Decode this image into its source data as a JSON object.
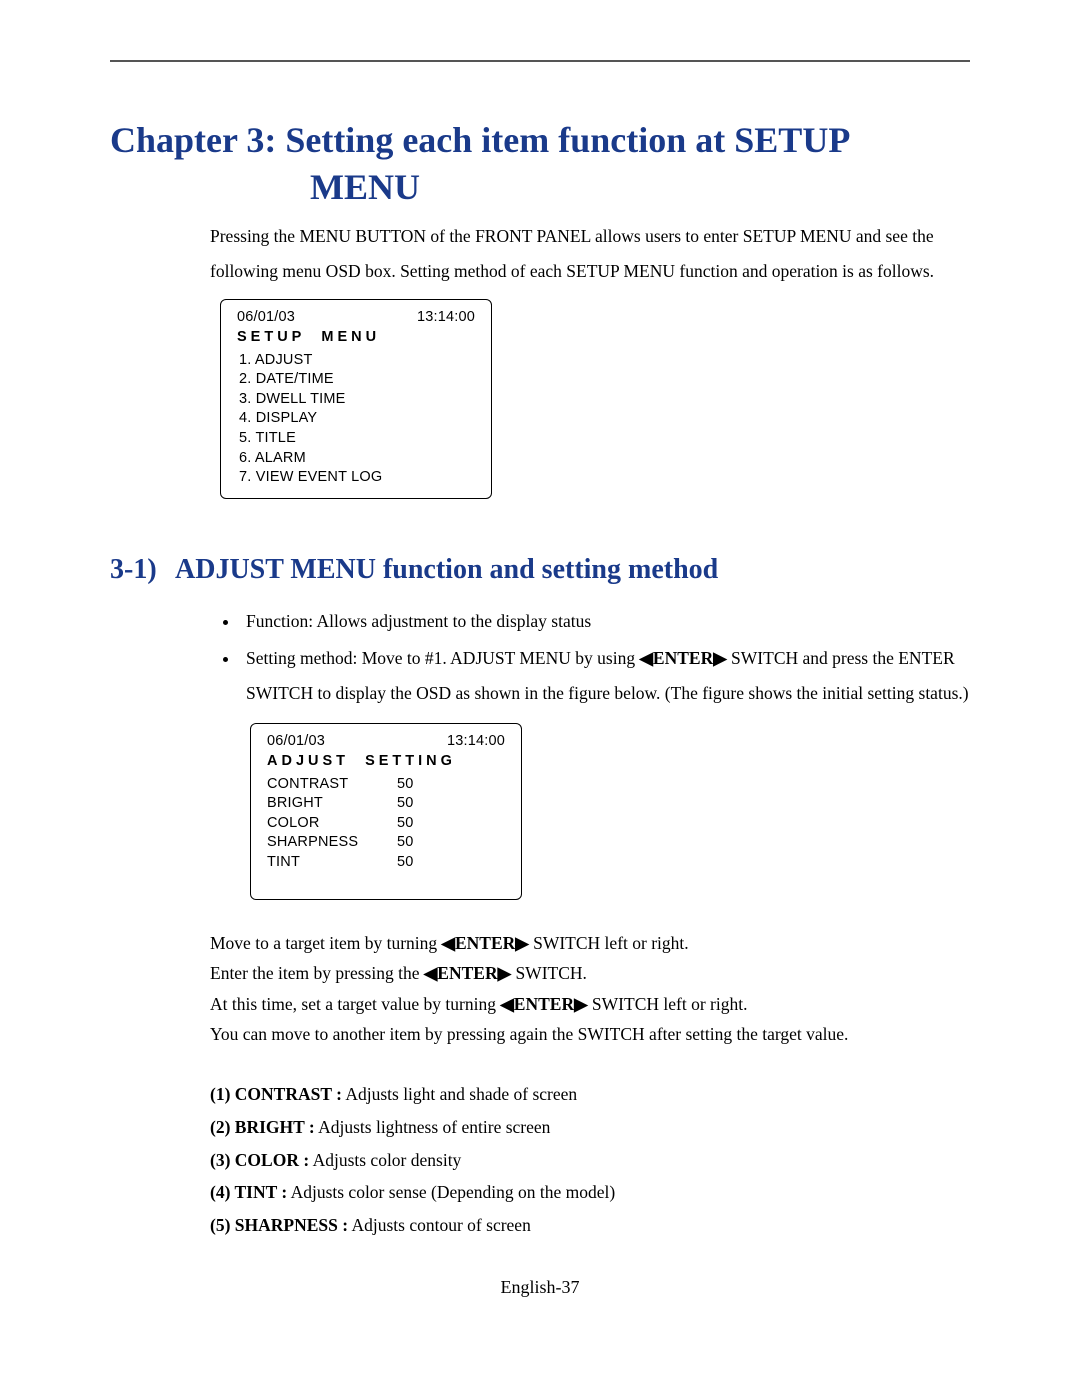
{
  "chapter": {
    "line1": "Chapter 3:  Setting each item function at SETUP",
    "line2": "MENU"
  },
  "intro": {
    "p1": "Pressing the MENU BUTTON of the FRONT PANEL allows users to enter SETUP MENU and see the",
    "p2": "following menu OSD box. Setting method of each SETUP MENU function and operation is as follows."
  },
  "osd1": {
    "date": "06/01/03",
    "time": "13:14:00",
    "title_a": "SETUP",
    "title_b": "MENU",
    "items": {
      "i1": "1. ADJUST",
      "i2": "2. DATE/TIME",
      "i3": "3. DWELL TIME",
      "i4": "4. DISPLAY",
      "i5": "5. TITLE",
      "i6": "6. ALARM",
      "i7": "7. VIEW EVENT LOG"
    }
  },
  "section": {
    "num": "3-1)",
    "title": "ADJUST MENU function and setting method"
  },
  "bullets": {
    "b1": "Function: Allows adjustment to the display status",
    "b2a": "Setting method: Move to #1. ADJUST MENU by using ",
    "b2_enter": "◀ENTER▶",
    "b2b": " SWITCH and press the ENTER SWITCH to display the OSD as shown in the figure below. (The figure shows the initial setting status.)"
  },
  "osd2": {
    "date": "06/01/03",
    "time": "13:14:00",
    "title_a": "ADJUST",
    "title_b": "SETTING",
    "rows": {
      "r1l": "CONTRAST",
      "r1v": "50",
      "r2l": "BRIGHT",
      "r2v": "50",
      "r3l": "COLOR",
      "r3v": "50",
      "r4l": "SHARPNESS",
      "r4v": "50",
      "r5l": "TINT",
      "r5v": "50"
    }
  },
  "para": {
    "l1a": "Move to a target item by turning ",
    "l1b": " SWITCH left or right.",
    "l2a": "Enter the item by pressing the ",
    "l2b": " SWITCH.",
    "l3a": "At this time, set a target value by turning ",
    "l3b": " SWITCH left or right.",
    "l4": "You can move to another item by pressing again the SWITCH after setting the target value.",
    "enter": "◀ENTER▶"
  },
  "defs": {
    "d1b": "(1) CONTRAST :",
    "d1t": " Adjusts light and shade of screen",
    "d2b": "(2) BRIGHT :",
    "d2t": " Adjusts lightness of entire screen",
    "d3b": "(3) COLOR :",
    "d3t": " Adjusts color density",
    "d4b": "(4) TINT :",
    "d4t": " Adjusts color sense (Depending on the model)",
    "d5b": "(5) SHARPNESS :",
    "d5t": " Adjusts contour of screen"
  },
  "footer": "English-37"
}
